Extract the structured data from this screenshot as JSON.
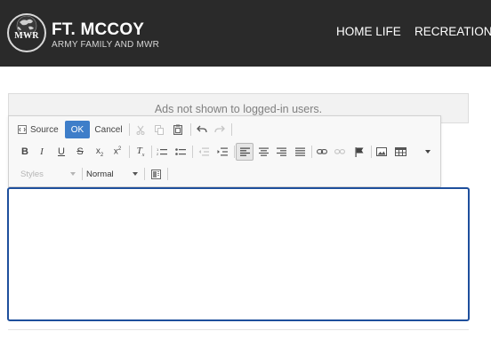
{
  "header": {
    "logo_text": "MWR",
    "title": "FT. MCCOY",
    "subtitle": "ARMY FAMILY AND MWR",
    "nav": [
      {
        "label": "HOME LIFE"
      },
      {
        "label": "RECREATION"
      }
    ]
  },
  "ads": {
    "message": "Ads not shown to logged-in users."
  },
  "editor": {
    "toolbar": {
      "source_label": "Source",
      "ok_label": "OK",
      "cancel_label": "Cancel",
      "styles_value": "Styles",
      "format_value": "Normal"
    },
    "content": ""
  },
  "colors": {
    "header_bg": "#2a2a2a",
    "ok_button": "#3e7ec9",
    "editor_border": "#1e4f9c"
  },
  "icons": {
    "row1": [
      "source-icon",
      "cut-icon",
      "copy-icon",
      "paste-icon",
      "undo-icon",
      "redo-icon"
    ],
    "row2": [
      "bold-icon",
      "italic-icon",
      "underline-icon",
      "strikethrough-icon",
      "subscript-icon",
      "superscript-icon",
      "remove-format-icon",
      "numbered-list-icon",
      "bulleted-list-icon",
      "outdent-icon",
      "indent-icon",
      "align-left-icon",
      "align-center-icon",
      "align-right-icon",
      "justify-icon",
      "link-icon",
      "unlink-icon",
      "anchor-flag-icon",
      "image-icon",
      "table-icon",
      "more-dropdown-icon"
    ],
    "row3": [
      "template-icon"
    ]
  }
}
